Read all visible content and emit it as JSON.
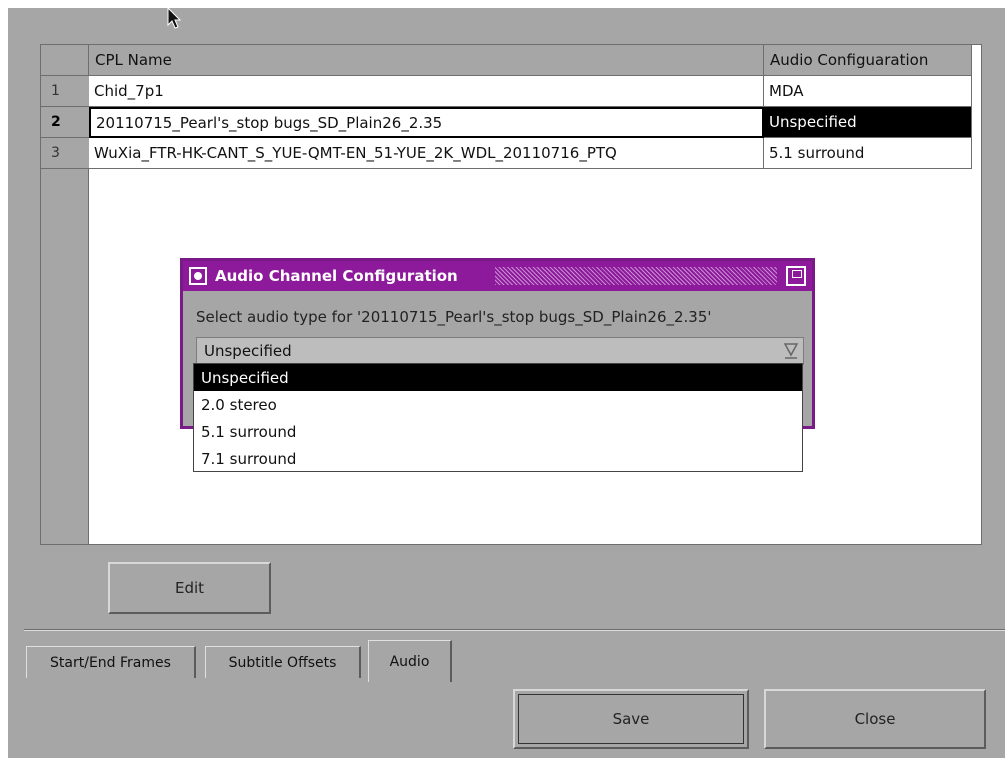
{
  "table": {
    "headers": {
      "name": "CPL Name",
      "audio": "Audio Configuaration"
    },
    "rows": [
      {
        "num": "1",
        "name": "Chid_7p1",
        "audio": "MDA"
      },
      {
        "num": "2",
        "name": "20110715_Pearl's_stop bugs_SD_Plain26_2.35",
        "audio": "Unspecified"
      },
      {
        "num": "3",
        "name": "WuXia_FTR-HK-CANT_S_YUE-QMT-EN_51-YUE_2K_WDL_20110716_PTQ",
        "audio": "5.1 surround"
      }
    ]
  },
  "dialog": {
    "title": "Audio Channel Configuration",
    "prompt": "Select audio type for '20110715_Pearl's_stop bugs_SD_Plain26_2.35'",
    "selected": "Unspecified",
    "options": [
      "Unspecified",
      "2.0 stereo",
      "5.1 surround",
      "7.1 surround"
    ]
  },
  "buttons": {
    "edit": "Edit",
    "save": "Save",
    "close": "Close"
  },
  "tabs": [
    "Start/End Frames",
    "Subtitle Offsets",
    "Audio"
  ],
  "colors": {
    "dialog_title": "#8d1a9b",
    "background": "#a6a6a6",
    "selection": "#000000"
  }
}
